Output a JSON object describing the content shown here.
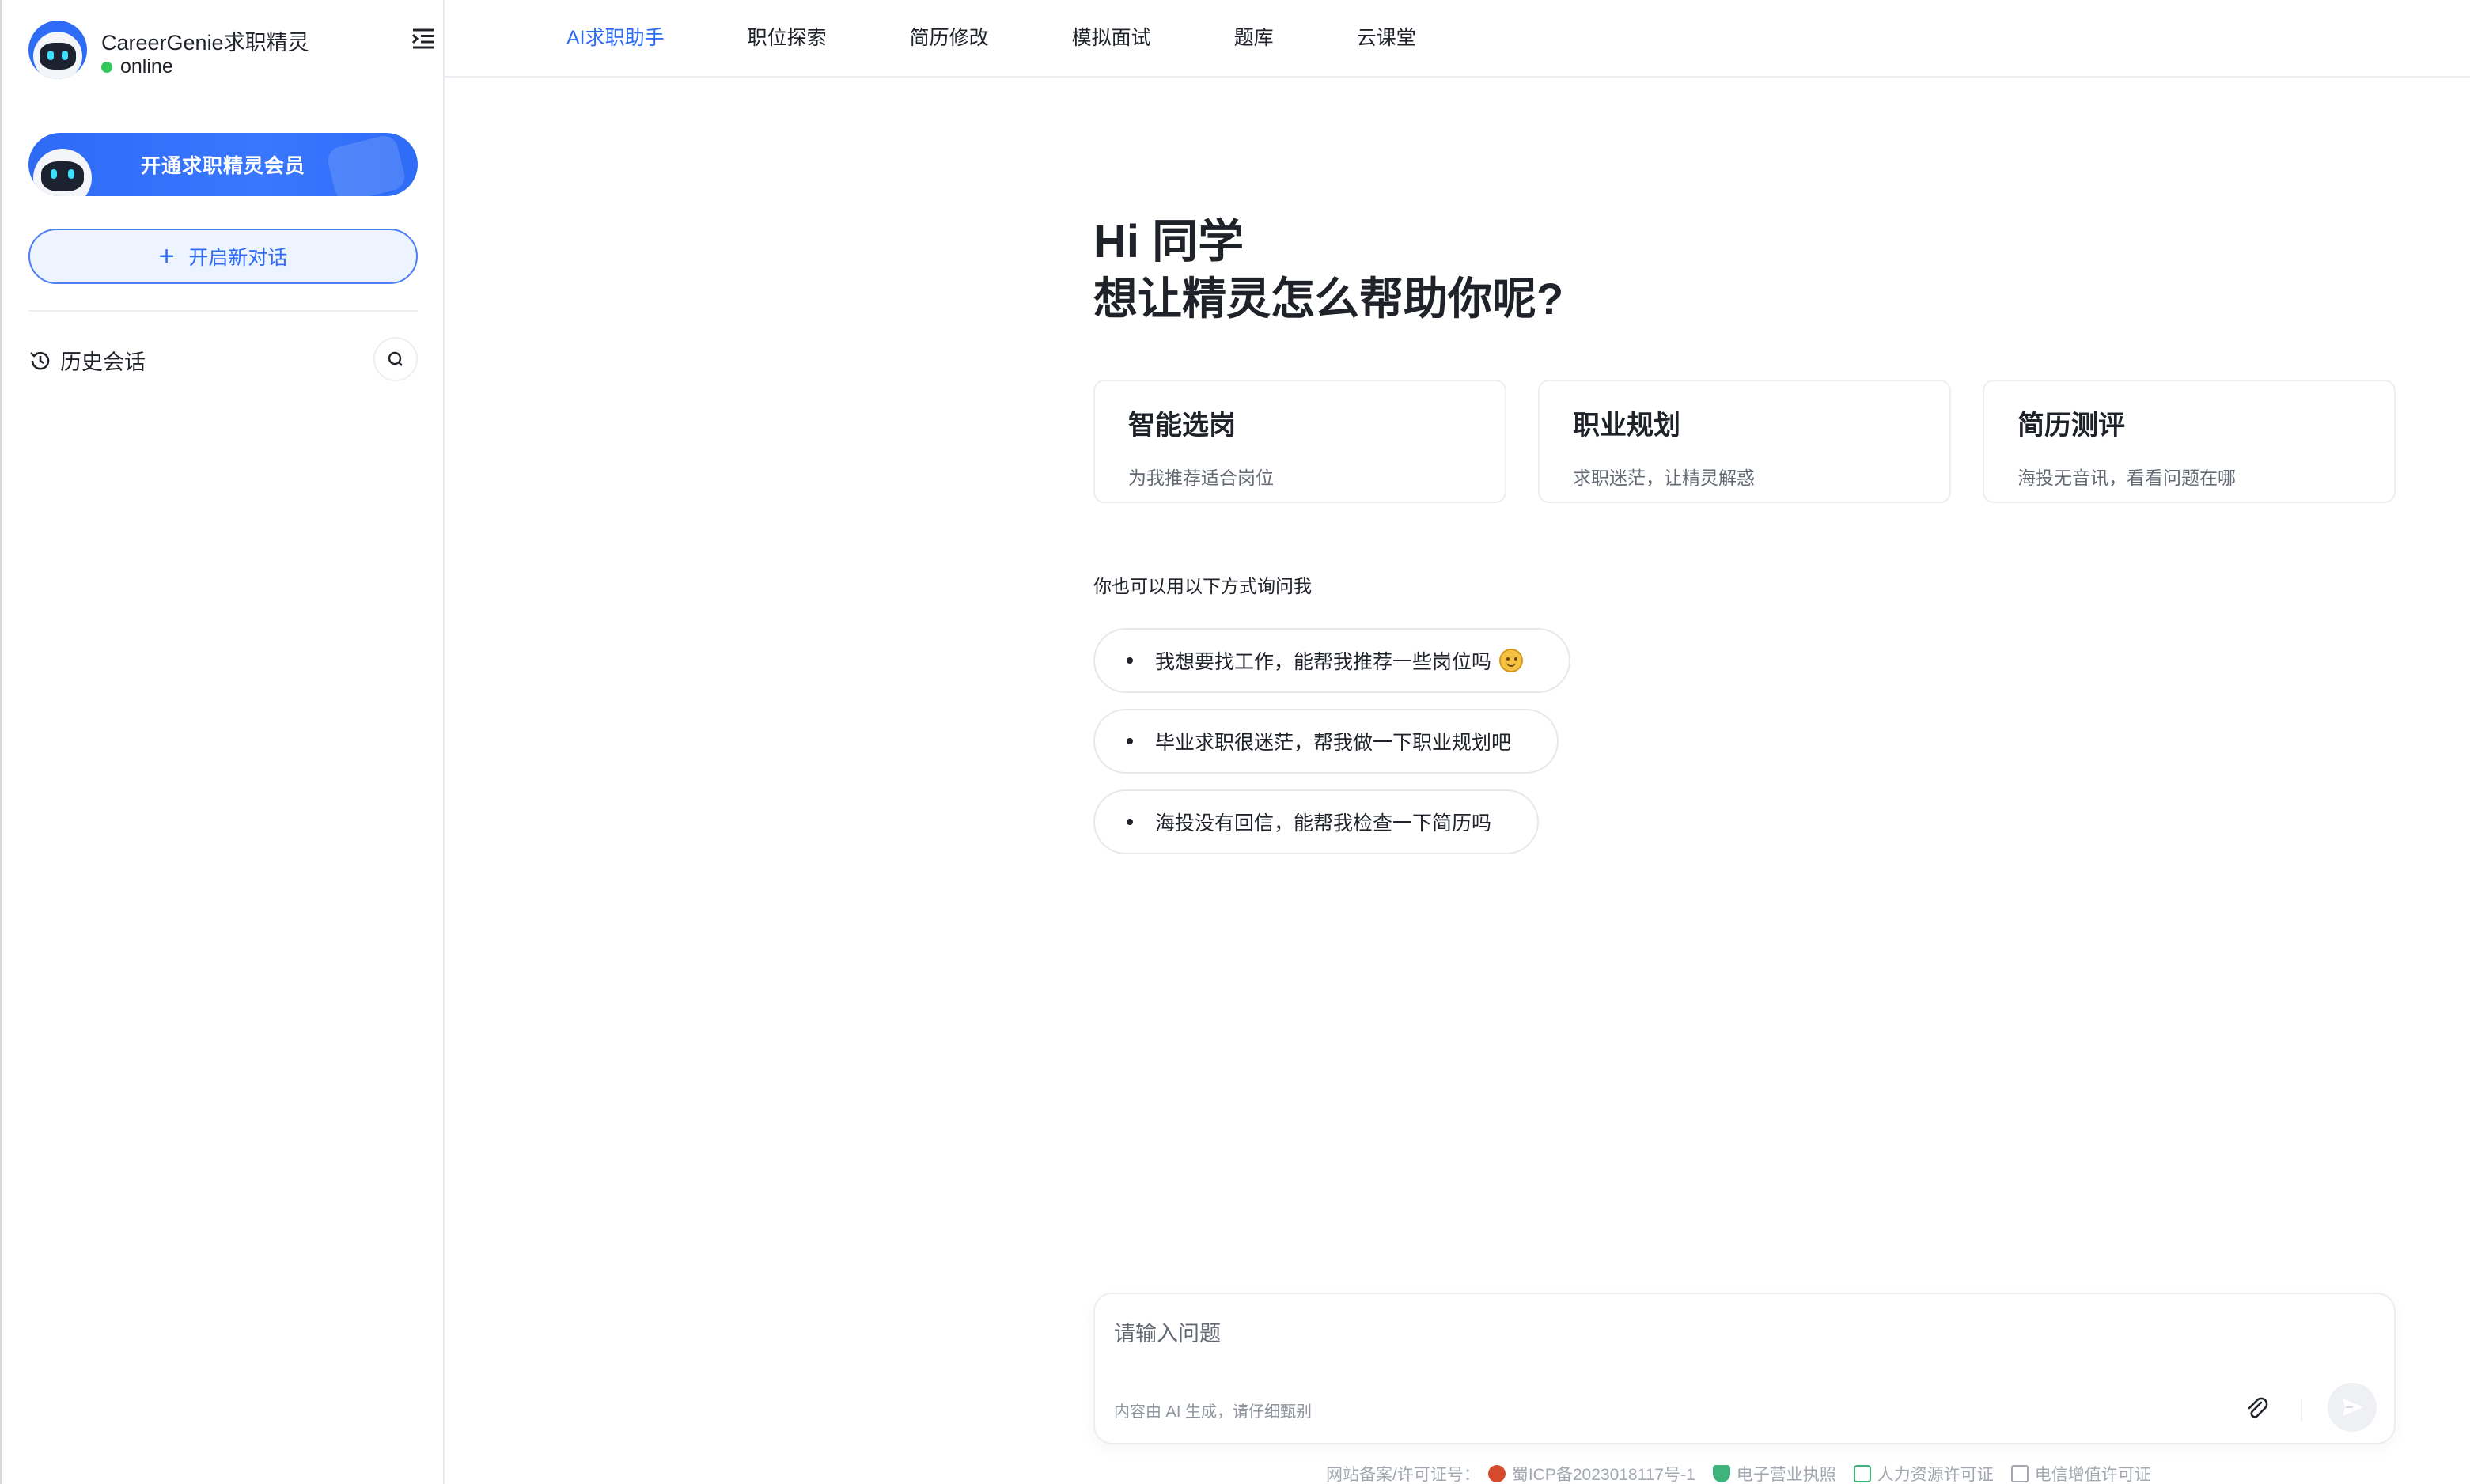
{
  "brand": {
    "name": "CareerGenie求职精灵",
    "status": "online"
  },
  "sidebar": {
    "vip_button": "开通求职精灵会员",
    "new_chat_button": "开启新对话",
    "history_label": "历史会话"
  },
  "nav": {
    "tabs": [
      {
        "label": "AI求职助手",
        "active": true
      },
      {
        "label": "职位探索",
        "active": false
      },
      {
        "label": "简历修改",
        "active": false
      },
      {
        "label": "模拟面试",
        "active": false
      },
      {
        "label": "题库",
        "active": false
      },
      {
        "label": "云课堂",
        "active": false
      }
    ]
  },
  "main": {
    "greeting_line1": "Hi 同学",
    "greeting_line2": "想让精灵怎么帮助你呢?",
    "cards": [
      {
        "title": "智能选岗",
        "subtitle": "为我推荐适合岗位"
      },
      {
        "title": "职业规划",
        "subtitle": "求职迷茫，让精灵解惑"
      },
      {
        "title": "简历测评",
        "subtitle": "海投无音讯，看看问题在哪"
      }
    ],
    "ask_hint": "你也可以用以下方式询问我",
    "suggestions": [
      "我想要找工作，能帮我推荐一些岗位吗",
      "毕业求职很迷茫，帮我做一下职业规划吧",
      "海投没有回信，能帮我检查一下简历吗"
    ]
  },
  "input": {
    "placeholder": "请输入问题",
    "disclaimer": "内容由 AI 生成，请仔细甄别"
  },
  "footer": {
    "prefix": "网站备案/许可证号：",
    "icp": "蜀ICP备2023018117号-1",
    "business_license": "电子营业执照",
    "hr_license": "人力资源许可证",
    "telecom_license": "电信增值许可证"
  },
  "colors": {
    "accent": "#2f6cf6",
    "online": "#34c759",
    "text": "#1f2329",
    "muted": "#646a73"
  }
}
